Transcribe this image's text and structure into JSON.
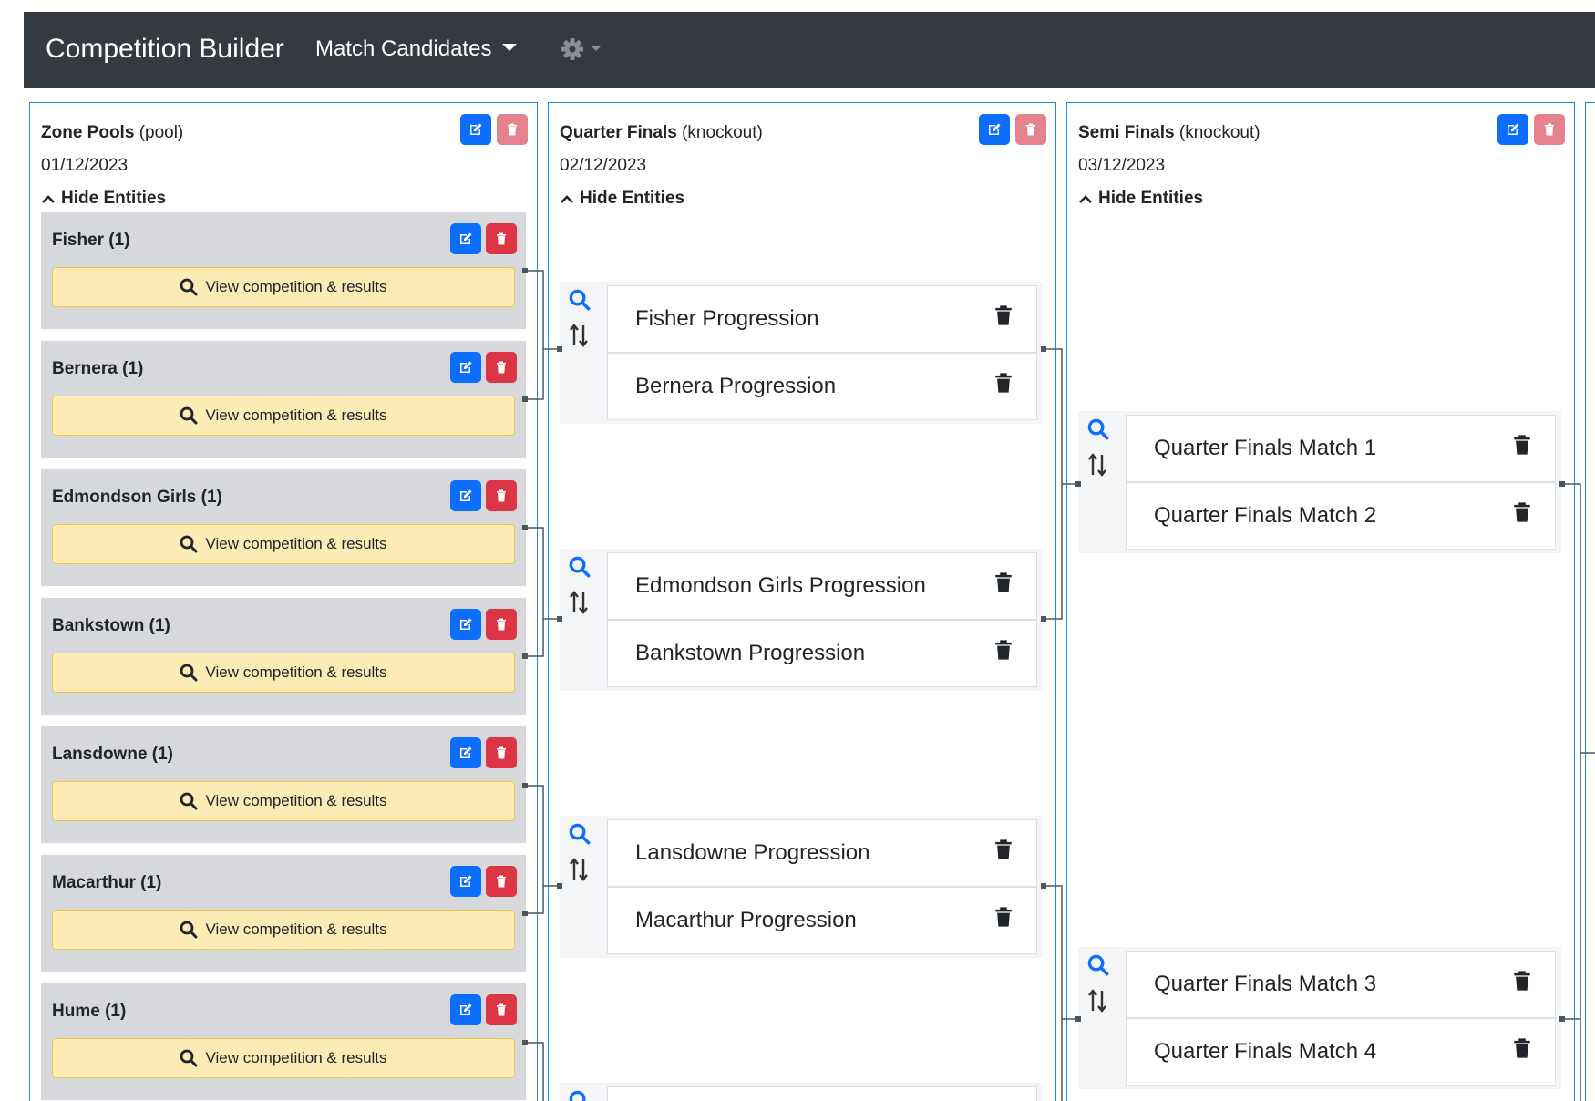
{
  "navbar": {
    "brand": "Competition Builder",
    "menu_label": "Match Candidates",
    "settings_icon": "gear-icon"
  },
  "colors": {
    "navbar_bg": "#343a40",
    "stage_border": "#1e88e5",
    "edit_button": "#0d6efd",
    "delete_button": "#dc3545",
    "view_button_bg": "#fdebb6",
    "pool_card_bg": "#d6d8db"
  },
  "stages": [
    {
      "name": "Zone Pools",
      "type": "(pool)",
      "date": "01/12/2023",
      "toggle_label": "Hide Entities"
    },
    {
      "name": "Quarter Finals",
      "type": "(knockout)",
      "date": "02/12/2023",
      "toggle_label": "Hide Entities"
    },
    {
      "name": "Semi Finals",
      "type": "(knockout)",
      "date": "03/12/2023",
      "toggle_label": "Hide Entities"
    }
  ],
  "pools": [
    {
      "name": "Fisher (1)",
      "action": "View competition & results"
    },
    {
      "name": "Bernera (1)",
      "action": "View competition & results"
    },
    {
      "name": "Edmondson Girls (1)",
      "action": "View competition & results"
    },
    {
      "name": "Bankstown (1)",
      "action": "View competition & results"
    },
    {
      "name": "Lansdowne (1)",
      "action": "View competition & results"
    },
    {
      "name": "Macarthur (1)",
      "action": "View competition & results"
    },
    {
      "name": "Hume (1)",
      "action": "View competition & results"
    }
  ],
  "quarter_final_matches": [
    {
      "entries": [
        "Fisher Progression",
        "Bernera Progression"
      ]
    },
    {
      "entries": [
        "Edmondson Girls Progression",
        "Bankstown Progression"
      ]
    },
    {
      "entries": [
        "Lansdowne Progression",
        "Macarthur Progression"
      ]
    }
  ],
  "semi_final_matches": [
    {
      "entries": [
        "Quarter Finals Match 1",
        "Quarter Finals Match 2"
      ]
    },
    {
      "entries": [
        "Quarter Finals Match 3",
        "Quarter Finals Match 4"
      ]
    }
  ]
}
